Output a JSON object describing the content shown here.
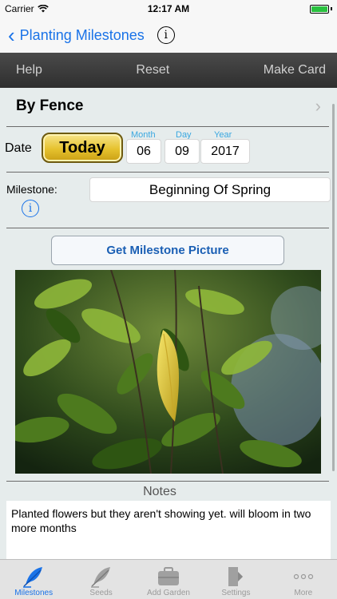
{
  "status_bar": {
    "carrier": "Carrier",
    "time": "12:17 AM"
  },
  "nav": {
    "back_label": "Planting Milestones",
    "info_icon": "info-icon"
  },
  "toolbar": {
    "help": "Help",
    "reset": "Reset",
    "make_card": "Make Card"
  },
  "location": {
    "name": "By Fence"
  },
  "date": {
    "label": "Date",
    "today_button": "Today",
    "month_label": "Month",
    "month": "06",
    "day_label": "Day",
    "day": "09",
    "year_label": "Year",
    "year": "2017"
  },
  "milestone": {
    "label": "Milestone:",
    "value": "Beginning Of Spring"
  },
  "get_picture_button": "Get Milestone Picture",
  "notes": {
    "label": "Notes",
    "text": "Planted flowers but they aren't showing yet. will bloom in two more months"
  },
  "tabs": [
    {
      "label": "Milestones",
      "icon": "quill-icon",
      "active": true
    },
    {
      "label": "Seeds",
      "icon": "quill-icon"
    },
    {
      "label": "Add Garden",
      "icon": "briefcase-icon"
    },
    {
      "label": "Settings",
      "icon": "door-icon"
    },
    {
      "label": "More",
      "icon": "ellipsis-icon"
    }
  ],
  "colors": {
    "accent": "#1a73e8",
    "toolbar": "#3a3a3a",
    "today_button": "#e6c22e",
    "date_labels": "#3aa7e0"
  }
}
